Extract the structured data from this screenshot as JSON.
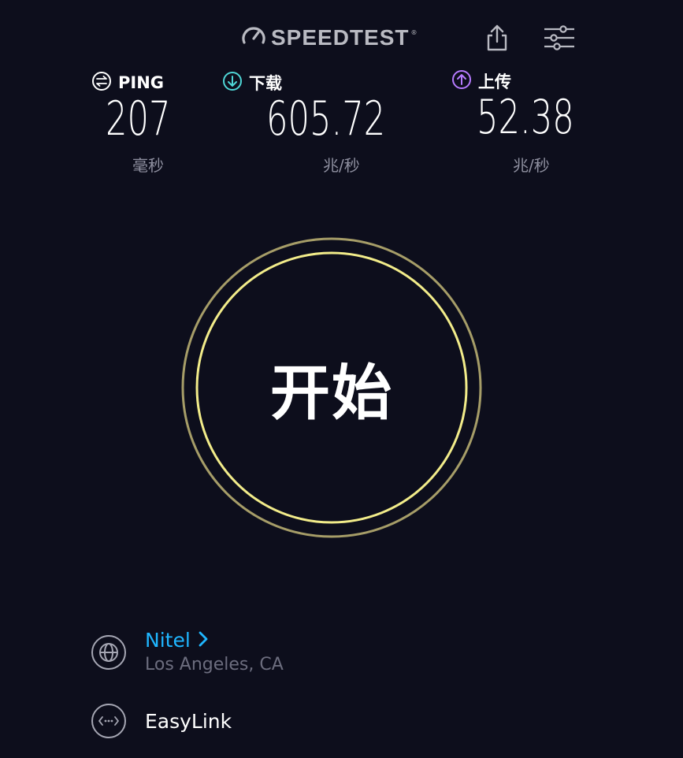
{
  "header": {
    "logo_text": "SPEEDTEST",
    "logo_tm": "®",
    "logo_icon": "gauge-icon",
    "share_icon": "share-icon",
    "settings_icon": "sliders-icon"
  },
  "metrics": {
    "ping": {
      "label": "PING",
      "value": "207",
      "unit": "毫秒",
      "icon": "ping-icon",
      "icon_color": "#ffffff"
    },
    "download": {
      "label": "下载",
      "value": "605.72",
      "unit": "兆/秒",
      "icon": "download-arrow-icon",
      "icon_color": "#4fd6d6"
    },
    "upload": {
      "label": "上传",
      "value": "52.38",
      "unit": "兆/秒",
      "icon": "upload-arrow-icon",
      "icon_color": "#b67bff"
    }
  },
  "go_button": {
    "label": "开始",
    "ring_inner_color": "#f2ec8a",
    "ring_outer_color": "#a69d68"
  },
  "isp": {
    "name": "Nitel",
    "location": "Los Angeles, CA",
    "icon": "globe-icon",
    "accent": "#1fb6ff"
  },
  "connection": {
    "name": "EasyLink",
    "icon": "connection-dots-icon"
  }
}
